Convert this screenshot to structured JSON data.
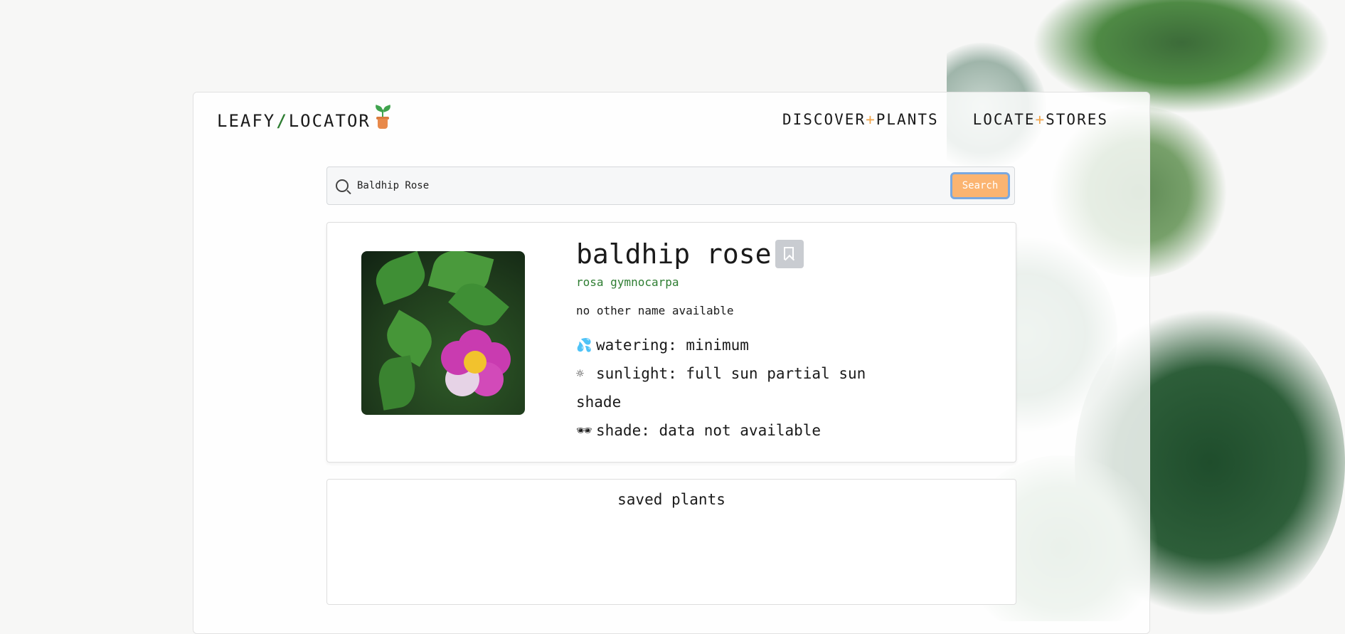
{
  "brand": {
    "left": "LEAFY",
    "slash": "/",
    "right": "LOCATOR"
  },
  "nav": [
    {
      "before": "DISCOVER",
      "star": "+",
      "after": "PLANTS"
    },
    {
      "before": "LOCATE",
      "star": "+",
      "after": "STORES"
    }
  ],
  "search": {
    "value": "Baldhip Rose",
    "button_label": "Search"
  },
  "plant": {
    "common_name": "baldhip rose",
    "scientific_name": "rosa gymnocarpa",
    "other_name": "no other name available",
    "watering": "watering: minimum",
    "sunlight": "sunlight: full sun partial sun",
    "sunlight_cont": "shade",
    "shade": "shade: data not available",
    "icons": {
      "watering": "💦",
      "sunlight": "☼",
      "shade": "🕶"
    }
  },
  "saved": {
    "title": "saved plants"
  },
  "colors": {
    "accent": "#fbb471",
    "green": "#2e7d32",
    "star": "#f0a44b"
  }
}
